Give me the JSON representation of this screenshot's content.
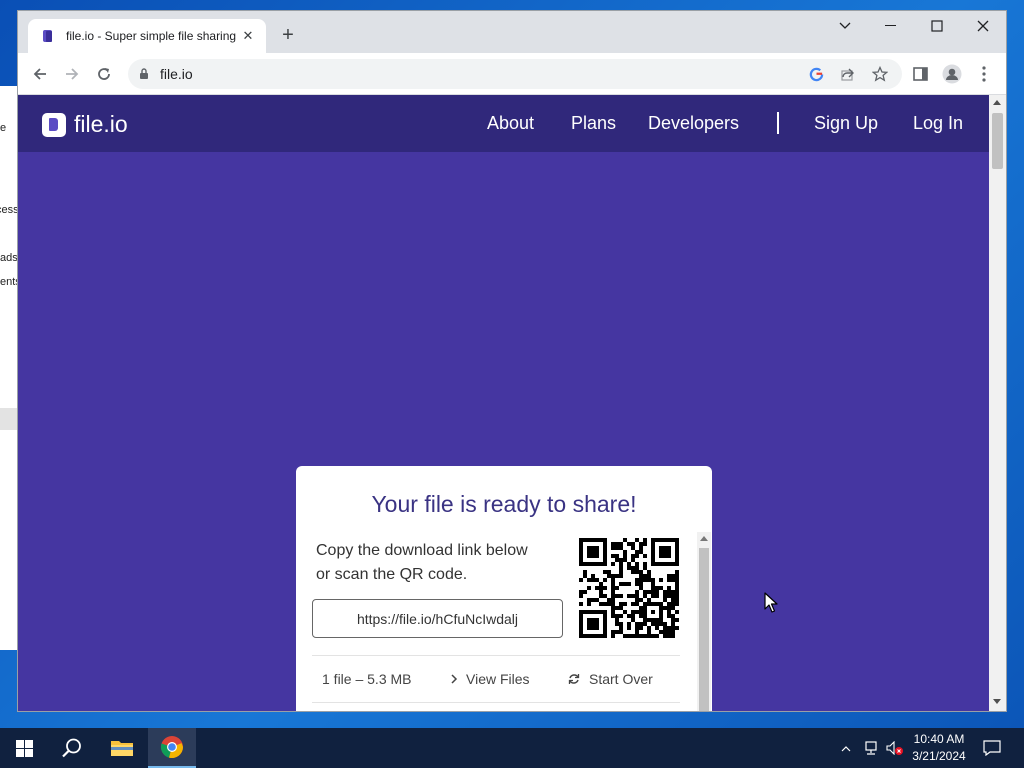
{
  "browser": {
    "tab_title": "file.io - Super simple file sharing",
    "url": "file.io",
    "tab_close_glyph": "✕",
    "new_tab_glyph": "+"
  },
  "site": {
    "logo_text": "file.io",
    "nav": [
      "About",
      "Plans",
      "Developers",
      "Sign Up",
      "Log In"
    ]
  },
  "share_card": {
    "title": "Your file is ready to share!",
    "description": "Copy the download link below or scan the QR code.",
    "link": "https://file.io/hCfuNcIwdalj",
    "file_info": "1 file – 5.3 MB",
    "view_files": "View Files",
    "start_over": "Start Over"
  },
  "background_window": {
    "fragments": [
      "e",
      "cess",
      "ads",
      "ents"
    ]
  },
  "taskbar": {
    "time": "10:40 AM",
    "date": "3/21/2024"
  },
  "colors": {
    "page_background": "#4536a1",
    "site_nav": "#30287b",
    "card_title": "#3a3383"
  }
}
